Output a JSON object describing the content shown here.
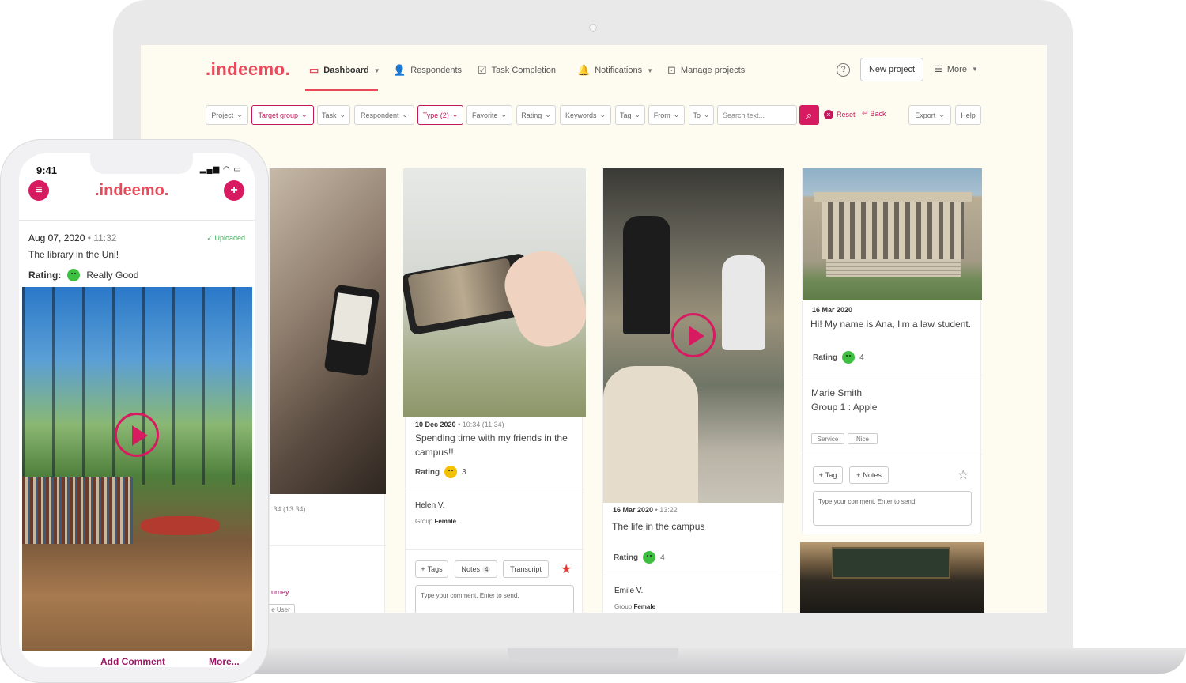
{
  "brand": {
    "name": ".indeemo.",
    "accent": "#e8495b",
    "primary": "#d81b60"
  },
  "nav": {
    "items": [
      {
        "label": "Dashboard",
        "icon": "calendar-icon",
        "active": true
      },
      {
        "label": "Respondents",
        "icon": "user-icon"
      },
      {
        "label": "Task Completion",
        "icon": "check-square-icon"
      },
      {
        "label": "Notifications",
        "icon": "bell-icon"
      },
      {
        "label": "Manage projects",
        "icon": "inbox-icon"
      }
    ],
    "help": "?",
    "new_project": "New project",
    "more": "More"
  },
  "filters": {
    "items": [
      "Project",
      "Target group",
      "Task",
      "Respondent",
      "Type (2)",
      "Favorite",
      "Rating",
      "Keywords",
      "Tag",
      "From",
      "To"
    ],
    "search_placeholder": "Search text...",
    "reset": "Reset",
    "back": "Back",
    "export": "Export",
    "help": "Help"
  },
  "cards": {
    "c1": {
      "time": ":34 (13:34)",
      "link": "urney",
      "chip": "e User"
    },
    "c2": {
      "date": "10 Dec 2020",
      "time": "• 10:34 (11:34)",
      "text": "Spending time with my friends in the campus!!",
      "rating_label": "Rating",
      "rating_value": "3",
      "name": "Helen V.",
      "group_label": "Group",
      "group_value": "Female",
      "tags": "Tags",
      "notes": "Notes",
      "notes_count": "4",
      "transcript": "Transcript",
      "comment_placeholder": "Type your comment. Enter to send."
    },
    "c3": {
      "date": "16 Mar 2020",
      "time": "• 13:22",
      "text": "The life in the campus",
      "rating_label": "Rating",
      "rating_value": "4",
      "name": "Emile V.",
      "group_label": "Group",
      "group_value": "Female"
    },
    "c4": {
      "date": "16 Mar 2020",
      "text": "Hi! My name is Ana, I'm a law student.",
      "rating_label": "Rating",
      "rating_value": "4",
      "name": "Marie Smith",
      "group": "Group 1 : Apple",
      "chips": [
        "Service",
        "Nice"
      ],
      "tag": "Tag",
      "notes": "Notes",
      "comment_placeholder": "Type your comment. Enter to send."
    }
  },
  "phone": {
    "time": "9:41",
    "logo": ".indeemo.",
    "date": "Aug 07, 2020",
    "clock": "• 11:32",
    "status": "Uploaded",
    "title": "The library in the Uni!",
    "rating_label": "Rating:",
    "rating_value": "Really Good",
    "add_comment": "Add Comment",
    "more": "More..."
  }
}
